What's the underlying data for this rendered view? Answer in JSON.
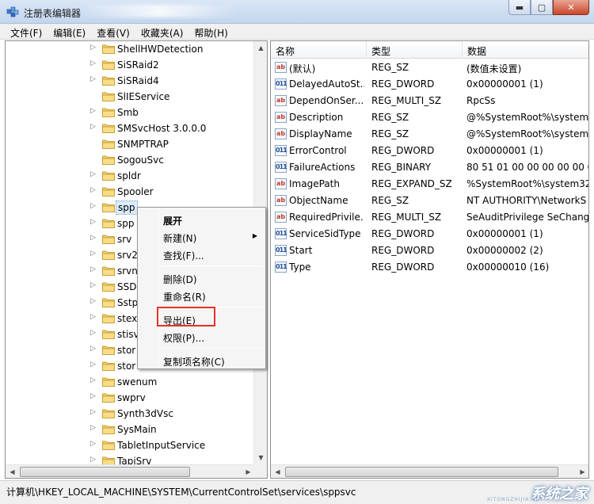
{
  "window": {
    "title": "注册表编辑器",
    "controls": {
      "minimize": "▬",
      "maximize": "▢",
      "close": "✕"
    }
  },
  "menubar": [
    "文件(F)",
    "编辑(E)",
    "查看(V)",
    "收藏夹(A)",
    "帮助(H)"
  ],
  "tree": {
    "items": [
      {
        "label": "ShellHWDetection",
        "expandable": true
      },
      {
        "label": "SiSRaid2",
        "expandable": true
      },
      {
        "label": "SiSRaid4",
        "expandable": true
      },
      {
        "label": "SlIEService",
        "expandable": false
      },
      {
        "label": "Smb",
        "expandable": true
      },
      {
        "label": "SMSvcHost 3.0.0.0",
        "expandable": true
      },
      {
        "label": "SNMPTRAP",
        "expandable": false
      },
      {
        "label": "SogouSvc",
        "expandable": false
      },
      {
        "label": "spldr",
        "expandable": true
      },
      {
        "label": "Spooler",
        "expandable": true
      },
      {
        "label": "spp",
        "expandable": true,
        "selected": true
      },
      {
        "label": "spp",
        "expandable": true
      },
      {
        "label": "srv",
        "expandable": true
      },
      {
        "label": "srv2",
        "expandable": true
      },
      {
        "label": "srvn",
        "expandable": true
      },
      {
        "label": "SSD",
        "expandable": true
      },
      {
        "label": "Sstp",
        "expandable": true
      },
      {
        "label": "stex",
        "expandable": true
      },
      {
        "label": "stisv",
        "expandable": true
      },
      {
        "label": "stor",
        "expandable": true
      },
      {
        "label": "stor",
        "expandable": true
      },
      {
        "label": "swenum",
        "expandable": true
      },
      {
        "label": "swprv",
        "expandable": true
      },
      {
        "label": "Synth3dVsc",
        "expandable": true
      },
      {
        "label": "SysMain",
        "expandable": true
      },
      {
        "label": "TabletInputService",
        "expandable": true
      },
      {
        "label": "TapiSrv",
        "expandable": true
      }
    ]
  },
  "list": {
    "columns": [
      "名称",
      "类型",
      "数据"
    ],
    "rows": [
      {
        "icon": "string",
        "name": "(默认)",
        "type": "REG_SZ",
        "data": "(数值未设置)"
      },
      {
        "icon": "binary",
        "name": "DelayedAutoSt...",
        "type": "REG_DWORD",
        "data": "0x00000001 (1)"
      },
      {
        "icon": "string",
        "name": "DependOnSer...",
        "type": "REG_MULTI_SZ",
        "data": "RpcSs"
      },
      {
        "icon": "string",
        "name": "Description",
        "type": "REG_SZ",
        "data": "@%SystemRoot%\\system3"
      },
      {
        "icon": "string",
        "name": "DisplayName",
        "type": "REG_SZ",
        "data": "@%SystemRoot%\\system3"
      },
      {
        "icon": "binary",
        "name": "ErrorControl",
        "type": "REG_DWORD",
        "data": "0x00000001 (1)"
      },
      {
        "icon": "binary",
        "name": "FailureActions",
        "type": "REG_BINARY",
        "data": "80 51 01 00 00 00 00 00 0"
      },
      {
        "icon": "string",
        "name": "ImagePath",
        "type": "REG_EXPAND_SZ",
        "data": "%SystemRoot%\\system32\\"
      },
      {
        "icon": "string",
        "name": "ObjectName",
        "type": "REG_SZ",
        "data": "NT AUTHORITY\\NetworkS"
      },
      {
        "icon": "string",
        "name": "RequiredPrivile...",
        "type": "REG_MULTI_SZ",
        "data": "SeAuditPrivilege SeChange"
      },
      {
        "icon": "binary",
        "name": "ServiceSidType",
        "type": "REG_DWORD",
        "data": "0x00000001 (1)"
      },
      {
        "icon": "binary",
        "name": "Start",
        "type": "REG_DWORD",
        "data": "0x00000002 (2)"
      },
      {
        "icon": "binary",
        "name": "Type",
        "type": "REG_DWORD",
        "data": "0x00000010 (16)"
      }
    ]
  },
  "context_menu": {
    "items": [
      {
        "label": "展开",
        "bold": true
      },
      {
        "label": "新建(N)",
        "submenu": true
      },
      {
        "label": "查找(F)..."
      },
      {
        "separator": true
      },
      {
        "label": "删除(D)"
      },
      {
        "label": "重命名(R)"
      },
      {
        "separator": true
      },
      {
        "label": "导出(E)",
        "highlighted": true
      },
      {
        "label": "权限(P)..."
      },
      {
        "separator": true
      },
      {
        "label": "复制项名称(C)"
      }
    ],
    "highlight_color": "#e5322d"
  },
  "status": {
    "path": "计算机\\HKEY_LOCAL_MACHINE\\SYSTEM\\CurrentControlSet\\services\\sppsvc"
  },
  "watermark": {
    "text": "系统之家",
    "sub": "XITONGZHIJIA.NET"
  },
  "icons": {
    "string": "ab",
    "binary": "011"
  }
}
